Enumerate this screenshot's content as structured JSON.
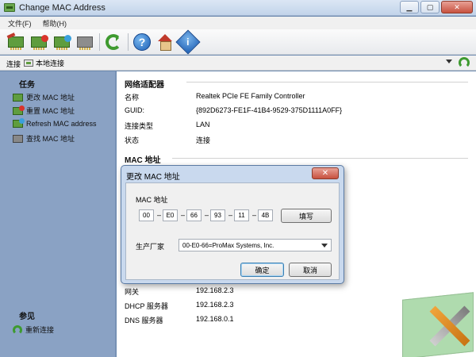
{
  "window": {
    "title": "Change MAC Address"
  },
  "menu": [
    "文件(F)",
    "帮助(H)"
  ],
  "toolbar": {
    "buttons": [
      {
        "name": "change-mac",
        "icon": "nic-modify-icon"
      },
      {
        "name": "reset-mac",
        "icon": "nic-reset-icon"
      },
      {
        "name": "refresh-mac",
        "icon": "nic-refresh-icon"
      },
      {
        "name": "find-mac",
        "icon": "nic-find-icon"
      },
      {
        "name": "refresh",
        "icon": "refresh-icon"
      },
      {
        "name": "help",
        "icon": "help-icon",
        "glyph": "?"
      },
      {
        "name": "home",
        "icon": "home-icon"
      },
      {
        "name": "about",
        "icon": "info-icon",
        "glyph": "i"
      }
    ]
  },
  "connection": {
    "label": "连接",
    "value": "本地连接"
  },
  "sidebar": {
    "tasks_title": "任务",
    "tasks": [
      {
        "label": "更改 MAC 地址",
        "icon": "nic-modify-icon"
      },
      {
        "label": "重置 MAC 地址",
        "icon": "nic-reset-icon"
      },
      {
        "label": "Refresh MAC address",
        "icon": "nic-refresh-icon"
      },
      {
        "label": "查找 MAC 地址",
        "icon": "binoculars-icon"
      }
    ],
    "see_also_title": "参见",
    "see_also": [
      {
        "label": "重新连接",
        "icon": "reconnect-icon"
      }
    ]
  },
  "adapter": {
    "title": "网络适配器",
    "rows": [
      {
        "key": "名称",
        "value": "Realtek PCIe FE Family Controller"
      },
      {
        "key": "GUID:",
        "value": "{892D6273-FE1F-41B4-9529-375D1111A0FF}"
      },
      {
        "key": "连接类型",
        "value": "LAN"
      },
      {
        "key": "状态",
        "value": "连接"
      }
    ]
  },
  "mac_section": {
    "title": "MAC 地址"
  },
  "network": {
    "rows": [
      {
        "key": "网关",
        "value": "192.168.2.3"
      },
      {
        "key": "DHCP 服务器",
        "value": "192.168.2.3"
      },
      {
        "key": "DNS 服务器",
        "value": "192.168.0.1"
      }
    ]
  },
  "dialog": {
    "title": "更改 MAC 地址",
    "close_glyph": "✕",
    "mac_label": "MAC 地址",
    "octets": [
      "00",
      "E0",
      "66",
      "93",
      "11",
      "4B"
    ],
    "separator": "–",
    "fill_button": "填写",
    "vendor_label": "生产厂家",
    "vendor_value": "00-E0-66=ProMax Systems, Inc.",
    "ok_button": "确定",
    "cancel_button": "取消"
  }
}
